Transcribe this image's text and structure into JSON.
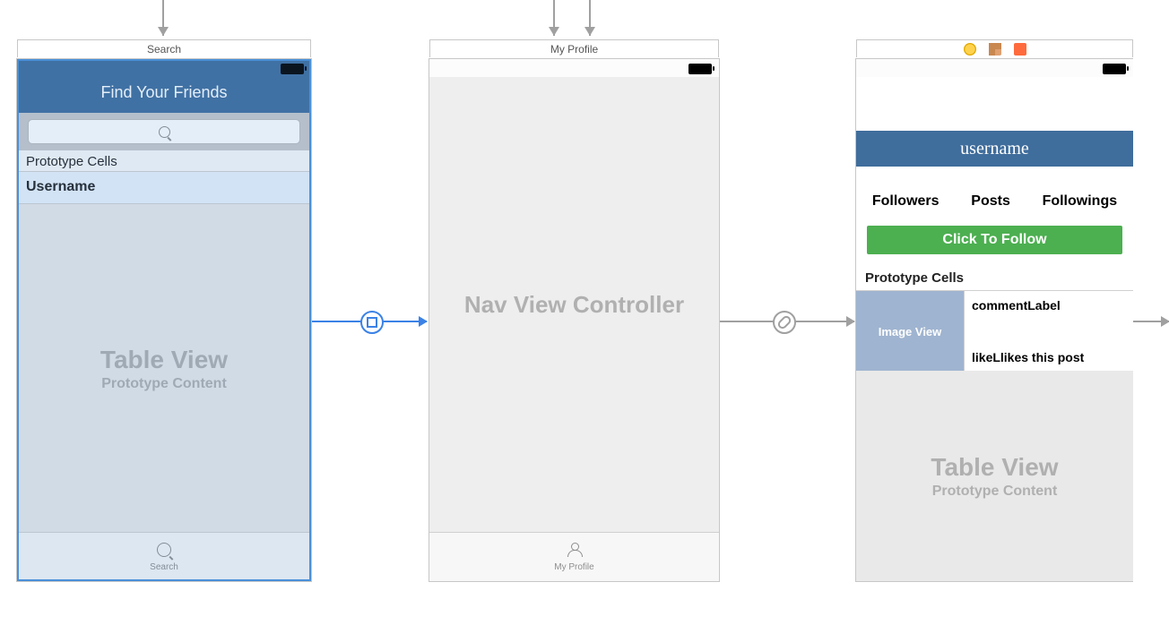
{
  "scene1": {
    "title": "Search",
    "nav_title": "Find Your Friends",
    "proto_header": "Prototype Cells",
    "cell_label": "Username",
    "tv_big": "Table View",
    "tv_small": "Prototype Content",
    "tab_label": "Search"
  },
  "scene2": {
    "title": "My Profile",
    "body_text": "Nav View Controller",
    "tab_label": "My Profile"
  },
  "scene3": {
    "username": "username",
    "stats": {
      "followers": "Followers",
      "posts": "Posts",
      "followings": "Followings"
    },
    "follow_btn": "Click To Follow",
    "proto_header": "Prototype Cells",
    "cell": {
      "image": "Image View",
      "comment": "commentLabel",
      "likes_lbl": "likeL",
      "likes_text": "likes this post"
    },
    "tv_big": "Table View",
    "tv_small": "Prototype Content"
  }
}
